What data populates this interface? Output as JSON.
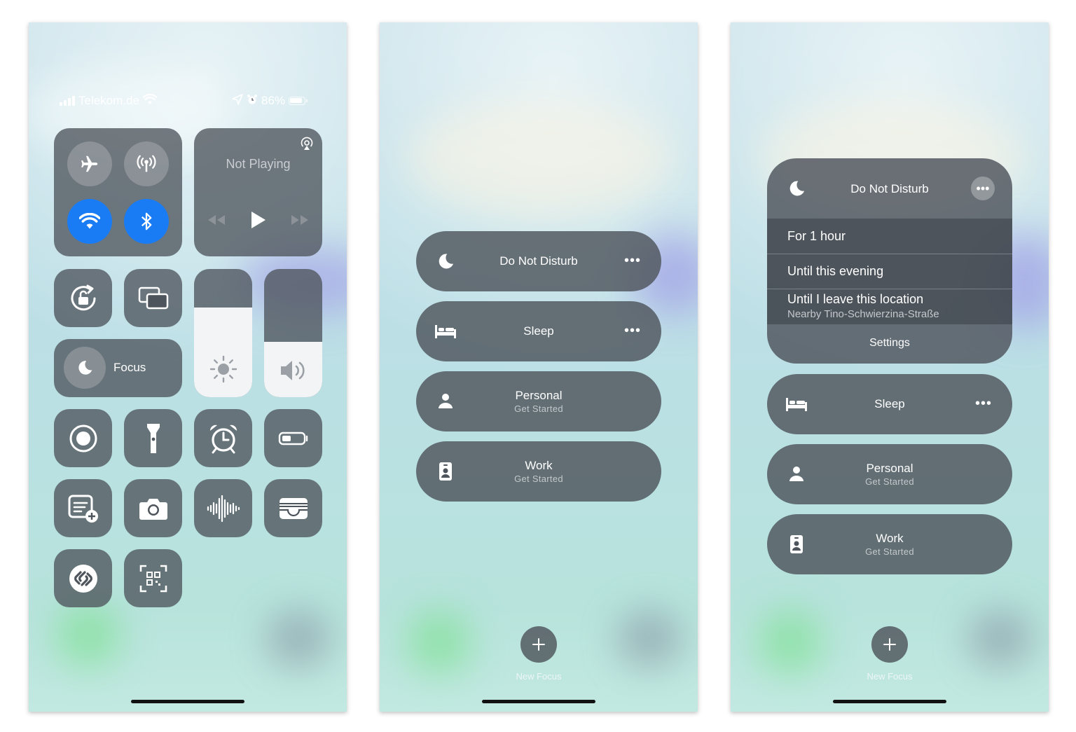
{
  "panel1": {
    "status_bar": {
      "carrier": "Telekom.de",
      "battery_percent": "86%",
      "signal_bars": 4,
      "icons": [
        "signal-bars-icon",
        "wifi-icon",
        "location-arrow-icon",
        "alarm-icon",
        "battery-icon"
      ]
    },
    "connectivity": {
      "airplane_mode": "off",
      "cellular_data": "off",
      "wifi": "on",
      "bluetooth": "on",
      "active_color": "#1a7cf5"
    },
    "media": {
      "title": "Not Playing",
      "icons": [
        "airplay-icon",
        "rewind-icon",
        "play-icon",
        "fast-forward-icon"
      ]
    },
    "brightness_level": 0.7,
    "volume_level": 0.43,
    "focus_label": "Focus",
    "tiles": [
      "screen-rotation-lock-icon",
      "screen-mirroring-icon",
      "screen-recording-icon",
      "flashlight-icon",
      "alarm-clock-icon",
      "low-power-mode-icon",
      "quick-note-icon",
      "camera-icon",
      "voice-memos-icon",
      "wallet-icon",
      "shazam-icon",
      "qr-code-scanner-icon"
    ]
  },
  "panel2": {
    "focus_modes": [
      {
        "title": "Do Not Disturb",
        "subtitle": "",
        "icon": "moon-icon",
        "has_more": true
      },
      {
        "title": "Sleep",
        "subtitle": "",
        "icon": "bed-icon",
        "has_more": true
      },
      {
        "title": "Personal",
        "subtitle": "Get Started",
        "icon": "person-icon",
        "has_more": false
      },
      {
        "title": "Work",
        "subtitle": "Get Started",
        "icon": "badge-icon",
        "has_more": false
      }
    ],
    "new_focus_label": "New Focus"
  },
  "panel3": {
    "dnd": {
      "title": "Do Not Disturb",
      "options": [
        "For 1 hour",
        "Until this evening",
        "Until I leave this location"
      ],
      "location_detail": "Nearby Tino-Schwierzina-Straße",
      "settings_label": "Settings"
    },
    "focus_modes": [
      {
        "title": "Sleep",
        "subtitle": "",
        "icon": "bed-icon"
      },
      {
        "title": "Personal",
        "subtitle": "Get Started",
        "icon": "person-icon"
      },
      {
        "title": "Work",
        "subtitle": "Get Started",
        "icon": "badge-icon"
      }
    ],
    "new_focus_label": "New Focus"
  },
  "colors": {
    "tile": "#4e545c",
    "accent_blue": "#1a7cf5",
    "background": "#c4e2e6"
  }
}
